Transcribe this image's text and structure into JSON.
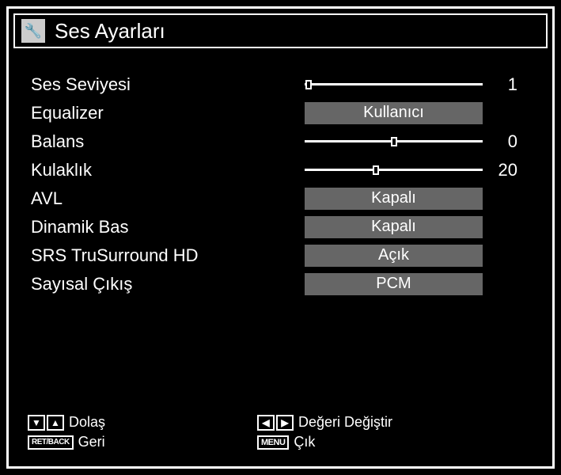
{
  "title": "Ses Ayarları",
  "rows": {
    "volume": {
      "label": "Ses Seviyesi",
      "value": "1",
      "pos": 2
    },
    "equalizer": {
      "label": "Equalizer",
      "option": "Kullanıcı"
    },
    "balance": {
      "label": "Balans",
      "value": "0",
      "pos": 50
    },
    "headphone": {
      "label": "Kulaklık",
      "value": "20",
      "pos": 40
    },
    "avl": {
      "label": "AVL",
      "option": "Kapalı"
    },
    "dynbass": {
      "label": "Dinamik Bas",
      "option": "Kapalı"
    },
    "srs": {
      "label": "SRS TruSurround HD",
      "option": "Açık"
    },
    "digital": {
      "label": "Sayısal Çıkış",
      "option": "PCM"
    }
  },
  "footer": {
    "navigate": "Dolaş",
    "back": "Geri",
    "back_key": "RET/BACK",
    "change": "Değeri Değiştir",
    "exit": "Çık",
    "exit_key": "MENU"
  }
}
